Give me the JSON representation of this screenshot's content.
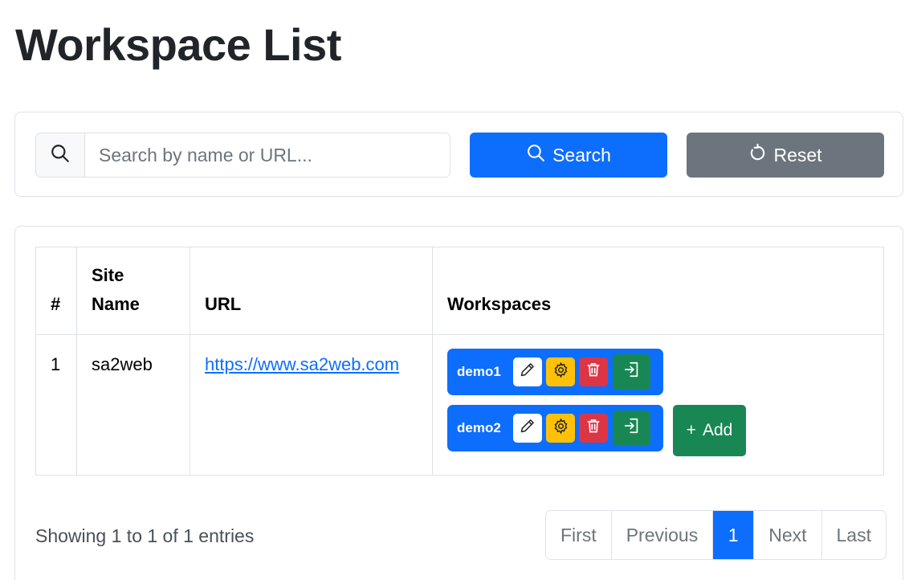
{
  "page": {
    "title": "Workspace List"
  },
  "search": {
    "placeholder": "Search by name or URL...",
    "value": "",
    "search_label": "Search",
    "reset_label": "Reset"
  },
  "table": {
    "headers": {
      "num": "#",
      "site_name": "Site Name",
      "url": "URL",
      "workspaces": "Workspaces"
    },
    "rows": [
      {
        "num": "1",
        "site_name": "sa2web",
        "url": "https://www.sa2web.com",
        "workspaces": [
          {
            "name": "demo1"
          },
          {
            "name": "demo2"
          }
        ],
        "add_label": "Add"
      }
    ]
  },
  "footer": {
    "entries_info": "Showing 1 to 1 of 1 entries",
    "pagination": {
      "first": "First",
      "previous": "Previous",
      "current": "1",
      "next": "Next",
      "last": "Last"
    }
  },
  "colors": {
    "primary": "#0d6efd",
    "secondary": "#6c757d",
    "success": "#198754",
    "warning": "#ffc107",
    "danger": "#dc3545"
  },
  "icons": {
    "search_prepend": "search-icon",
    "search_button": "search-icon",
    "reset_button": "reset-icon",
    "edit": "pencil-icon",
    "settings": "gear-icon",
    "delete": "trash-icon",
    "enter": "enter-icon",
    "add": "plus-icon"
  }
}
